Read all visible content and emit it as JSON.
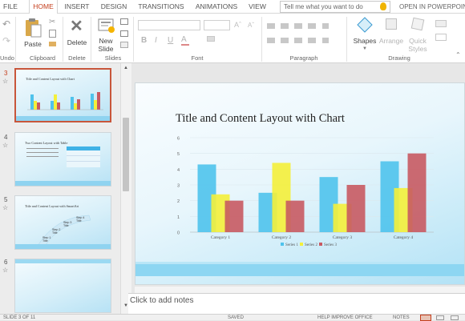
{
  "tabs": [
    {
      "label": "FILE",
      "active": false
    },
    {
      "label": "HOME",
      "active": true
    },
    {
      "label": "INSERT",
      "active": false
    },
    {
      "label": "DESIGN",
      "active": false
    },
    {
      "label": "TRANSITIONS",
      "active": false
    },
    {
      "label": "ANIMATIONS",
      "active": false
    },
    {
      "label": "VIEW",
      "active": false
    }
  ],
  "tell_me": {
    "placeholder": "Tell me what you want to do"
  },
  "open_in": "OPEN IN POWERPOINT",
  "ribbon": {
    "paste": "Paste",
    "delete": "Delete",
    "new_slide": "New Slide",
    "shapes": "Shapes",
    "arrange": "Arrange",
    "quick_styles": "Quick Styles",
    "groups": {
      "undo": "Undo",
      "clipboard": "Clipboard",
      "delete": "Delete",
      "slides": "Slides",
      "font": "Font",
      "paragraph": "Paragraph",
      "drawing": "Drawing"
    },
    "font_buttons": [
      "B",
      "I",
      "U",
      "A"
    ]
  },
  "slides": [
    {
      "num": "3",
      "title": "Title and Content Layout with Chart",
      "selected": true
    },
    {
      "num": "4",
      "title": "Two Content Layout with Table",
      "selected": false
    },
    {
      "num": "5",
      "title": "Title and Content Layout with SmartArt",
      "selected": false
    },
    {
      "num": "6",
      "title": "",
      "selected": false
    }
  ],
  "thumb_smartart": [
    "Step 1 Title",
    "Step 2 Title",
    "Step 3 Title",
    "Step 4 Title"
  ],
  "slide": {
    "title": "Title and Content Layout with Chart"
  },
  "notes": "Click to add notes",
  "status": {
    "slide_of": "SLIDE 3 OF 11",
    "saved": "SAVED",
    "help": "HELP IMPROVE OFFICE",
    "notes_btn": "NOTES"
  },
  "colors": {
    "accent": "#c43e1c",
    "series1": "#4fc3ec",
    "series2": "#f4f03a",
    "series3": "#c85a62"
  },
  "chart_data": {
    "type": "bar",
    "categories": [
      "Category 1",
      "Category 2",
      "Category 3",
      "Category 4"
    ],
    "series": [
      {
        "name": "Series 1",
        "values": [
          4.3,
          2.5,
          3.5,
          4.5
        ]
      },
      {
        "name": "Series 2",
        "values": [
          2.4,
          4.4,
          1.8,
          2.8
        ]
      },
      {
        "name": "Series 3",
        "values": [
          2,
          2,
          3,
          5
        ]
      }
    ],
    "yticks": [
      0,
      1,
      2,
      3,
      4,
      5,
      6
    ],
    "ylim": [
      0,
      6
    ],
    "grid": true,
    "legend": "bottom"
  }
}
